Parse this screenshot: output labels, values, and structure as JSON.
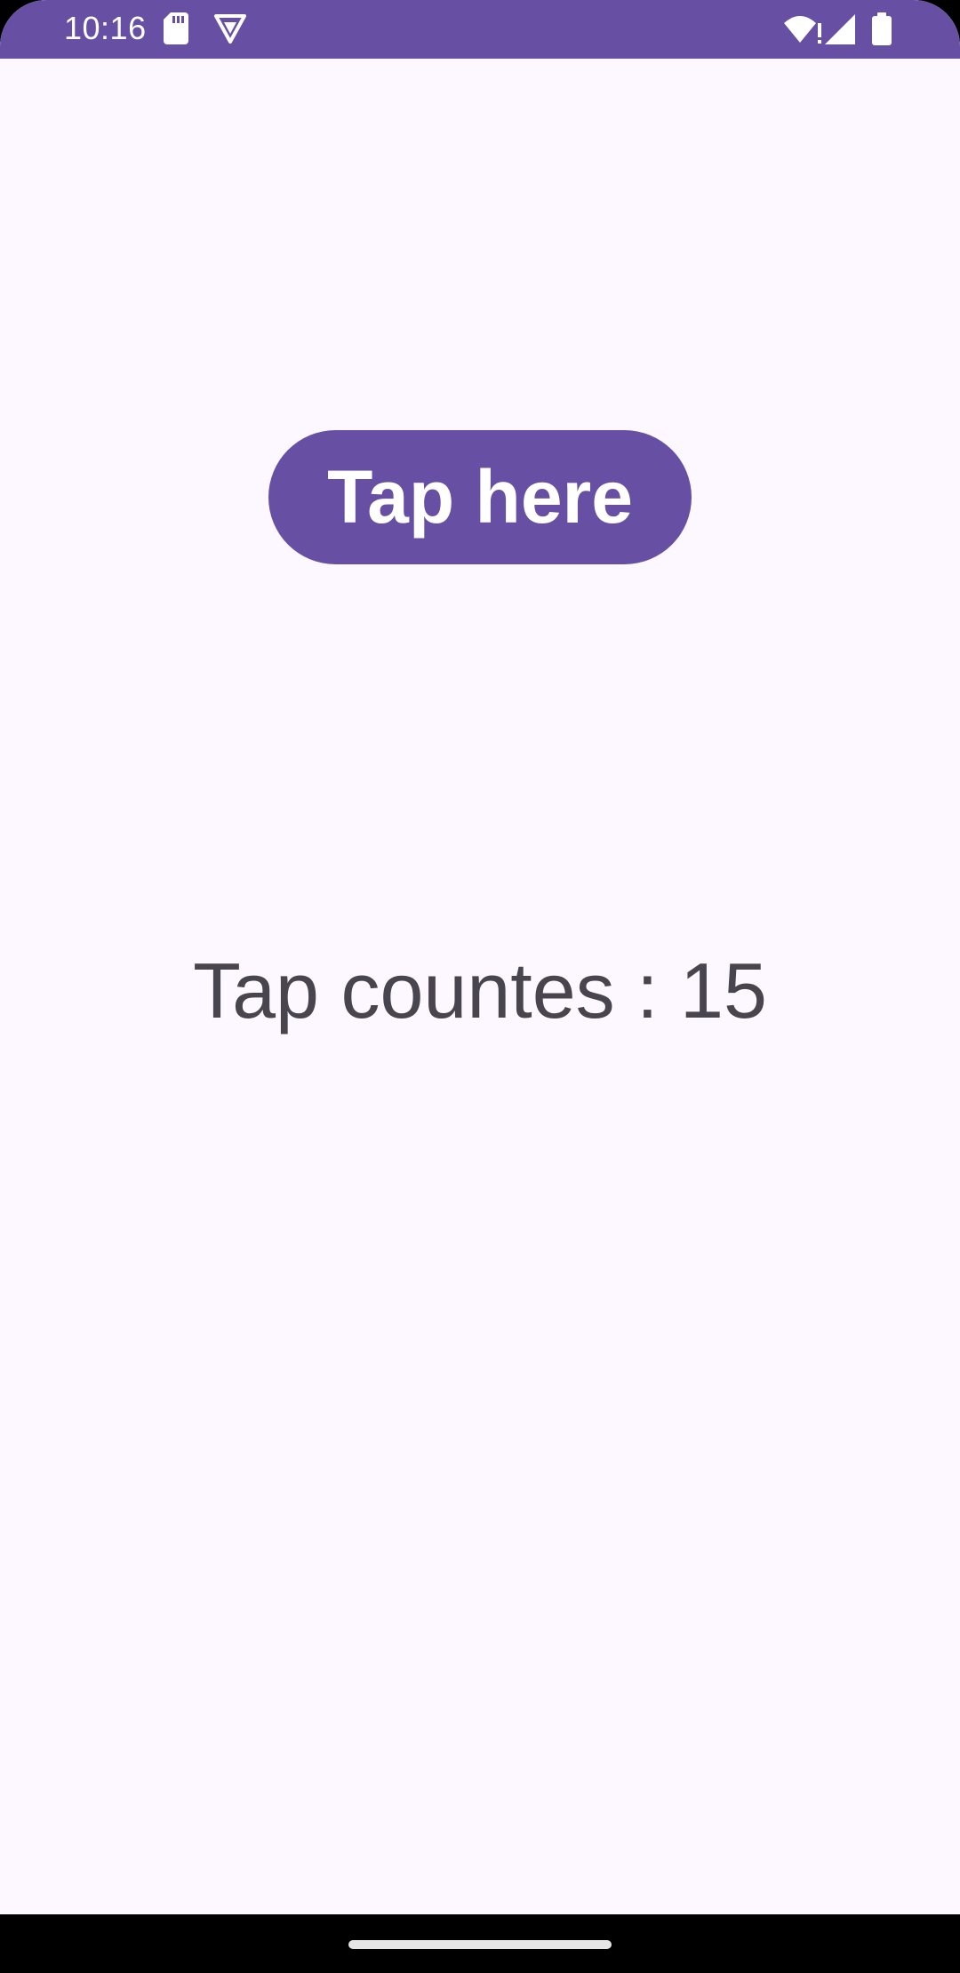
{
  "status_bar": {
    "time": "10:16",
    "background_color": "#6750a4",
    "icons": [
      "sd-card-icon",
      "vpn-icon",
      "wifi-alert-icon",
      "cell-signal-icon",
      "battery-icon"
    ]
  },
  "main": {
    "tap_button_label": "Tap here",
    "tap_count_text": "Tap countes : 15",
    "accent_color": "#6750a4",
    "background_color": "#fdf7ff",
    "text_color": "#49454f"
  },
  "nav_bar": {
    "handle": "home-handle"
  }
}
